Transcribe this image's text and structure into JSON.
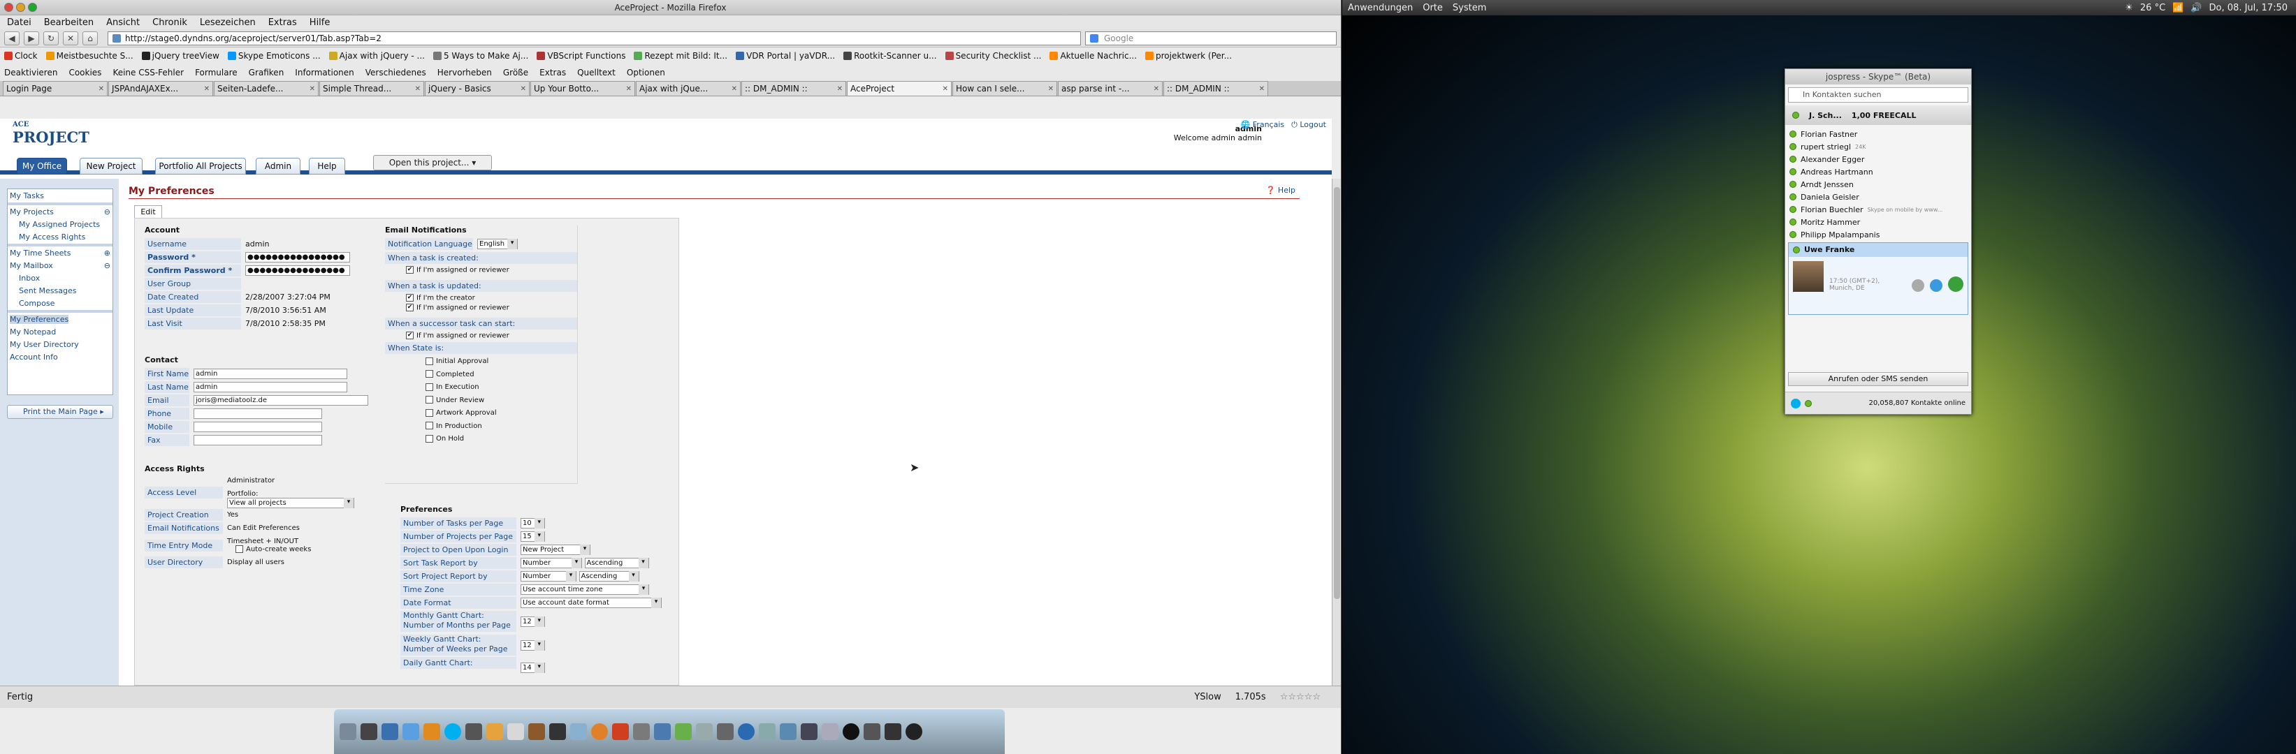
{
  "window": {
    "title": "AceProject - Mozilla Firefox"
  },
  "menu": [
    "Datei",
    "Bearbeiten",
    "Ansicht",
    "Chronik",
    "Lesezeichen",
    "Extras",
    "Hilfe"
  ],
  "nav": {
    "url": "http://stage0.dyndns.org/aceproject/server01/Tab.asp?Tab=2",
    "search_placeholder": "Google"
  },
  "bookmarks": [
    "Clock",
    "Meistbesuchte S...",
    "jQuery treeView",
    "Skype Emoticons ...",
    "Ajax with jQuery - ...",
    "5 Ways to Make Aj...",
    "VBScript Functions",
    "Rezept mit Bild: It...",
    "VDR Portal | yaVDR...",
    "Rootkit-Scanner u...",
    "Security Checklist ...",
    "Aktuelle Nachric...",
    "projektwerk (Per..."
  ],
  "devbar": [
    "Deaktivieren",
    "Cookies",
    "Keine CSS-Fehler",
    "Formulare",
    "Grafiken",
    "Informationen",
    "Verschiedenes",
    "Hervorheben",
    "Größe",
    "Extras",
    "Quelltext",
    "Optionen"
  ],
  "tabs": [
    {
      "label": "Login Page"
    },
    {
      "label": "JSPAndAJAXEx..."
    },
    {
      "label": "Seiten-Ladefe..."
    },
    {
      "label": "Simple Thread..."
    },
    {
      "label": "jQuery - Basics"
    },
    {
      "label": "Up Your Botto..."
    },
    {
      "label": "Ajax with jQue..."
    },
    {
      "label": ":: DM_ADMIN ::"
    },
    {
      "label": "AceProject",
      "active": true
    },
    {
      "label": "How can I sele..."
    },
    {
      "label": "asp parse int -..."
    },
    {
      "label": ":: DM_ADMIN ::"
    }
  ],
  "app": {
    "logo_top": "ACE",
    "logo": "PROJECT",
    "user": "admin",
    "welcome": "Welcome admin admin",
    "francais": "Français",
    "logout": "Logout",
    "buttons": [
      "My Office",
      "New Project",
      "Portfolio All Projects",
      "Admin",
      "Help"
    ],
    "open_project": "Open this project...",
    "sidebar": {
      "tasks": "My Tasks",
      "projects": "My Projects",
      "assigned": "My Assigned Projects",
      "access": "My Access Rights",
      "timesheets": "My Time Sheets",
      "mailbox": "My Mailbox",
      "inbox": "Inbox",
      "sent": "Sent Messages",
      "compose": "Compose",
      "prefs": "My Preferences",
      "notepad": "My Notepad",
      "userdir": "My User Directory",
      "account": "Account Info"
    },
    "print": "Print the Main Page",
    "page_title": "My Preferences",
    "help": "Help",
    "edit_tab": "Edit",
    "account": {
      "heading": "Account",
      "rows": [
        {
          "label": "Username",
          "value": "admin"
        },
        {
          "label": "Password *",
          "value": "●●●●●●●●●●●●●●●●"
        },
        {
          "label": "Confirm Password *",
          "value": "●●●●●●●●●●●●●●●●"
        },
        {
          "label": "User Group",
          "value": ""
        },
        {
          "label": "Date Created",
          "value": "2/28/2007 3:27:04 PM"
        },
        {
          "label": "Last Update",
          "value": "7/8/2010 3:56:51 AM"
        },
        {
          "label": "Last Visit",
          "value": "7/8/2010 2:58:35 PM"
        }
      ]
    },
    "contact": {
      "heading": "Contact",
      "rows": [
        {
          "label": "First Name",
          "value": "admin"
        },
        {
          "label": "Last Name",
          "value": "admin"
        },
        {
          "label": "Email",
          "value": "joris@mediatoolz.de"
        },
        {
          "label": "Phone",
          "value": ""
        },
        {
          "label": "Mobile",
          "value": ""
        },
        {
          "label": "Fax",
          "value": ""
        }
      ]
    },
    "access": {
      "heading": "Access Rights",
      "access_level_label": "Access Level",
      "administrator": "Administrator",
      "portfolio": "Portfolio:",
      "portfolio_value": "View all projects",
      "project_creation_label": "Project Creation",
      "project_creation": "Yes",
      "email_notif_label": "Email Notifications",
      "email_notif": "Can Edit Preferences",
      "time_entry_label": "Time Entry Mode",
      "time_entry": "Timesheet + IN/OUT",
      "auto_weeks": "Auto-create weeks",
      "user_dir_label": "User Directory",
      "user_dir": "Display all users"
    },
    "email": {
      "heading": "Email Notifications",
      "lang_label": "Notification Language",
      "lang_value": "English",
      "created": "When a task is created:",
      "created_opt": "If I'm assigned or reviewer",
      "updated": "When a task is updated:",
      "updated_opt1": "If I'm the creator",
      "updated_opt2": "If I'm assigned or reviewer",
      "successor": "When a successor task can start:",
      "successor_opt": "If I'm assigned or reviewer",
      "state": "When State is:",
      "states": [
        "Initial Approval",
        "Completed",
        "In Execution",
        "Under Review",
        "Artwork Approval",
        "In Production",
        "On Hold"
      ]
    },
    "prefs": {
      "heading": "Preferences",
      "rows": [
        {
          "label": "Number of Tasks per Page",
          "value": "10"
        },
        {
          "label": "Number of Projects per Page",
          "value": "15"
        },
        {
          "label": "Project to Open Upon Login",
          "value": "New Project"
        },
        {
          "label": "Sort Task Report by",
          "value": "Number",
          "value2": "Ascending"
        },
        {
          "label": "Sort Project Report by",
          "value": "Number",
          "value2": "Ascending"
        },
        {
          "label": "Time Zone",
          "value": "Use account time zone"
        },
        {
          "label": "Date Format",
          "value": "Use account date format"
        }
      ],
      "monthly1": "Monthly Gantt Chart:",
      "monthly2": "Number of Months per Page",
      "monthly_val": "12",
      "weekly1": "Weekly Gantt Chart:",
      "weekly2": "Number of Weeks per Page",
      "weekly_val": "12",
      "daily1": "Daily Gantt Chart:",
      "daily_val": "14"
    }
  },
  "statusbar": {
    "text": "Fertig",
    "yslow": "YSlow",
    "time": "1.705s"
  },
  "gnome": {
    "menus": [
      "Anwendungen",
      "Orte",
      "System"
    ],
    "temp": "26 °C",
    "clock": "Do, 08. Jul, 17:50"
  },
  "skype": {
    "title": "jospress - Skype™ (Beta)",
    "search": "In Kontakten suchen",
    "user": "J. Sch...",
    "credit": "1,00 FREECALL",
    "contacts": [
      "Florian Fastner",
      "rupert striegl",
      "Alexander Egger",
      "Andreas Hartmann",
      "Arndt Jenssen",
      "Daniela Geisler",
      "Florian Buechler",
      "Moritz Hammer",
      "Philipp Mpalampanis"
    ],
    "striegl_note": "24K",
    "buechler_note": "Skype on mobile by www...",
    "selected": "Uwe Franke",
    "selected_info": "17:50 (GMT+2), Munich, DE",
    "call_btn": "Anrufen oder SMS senden",
    "online": "20,058,807 Kontakte online"
  }
}
